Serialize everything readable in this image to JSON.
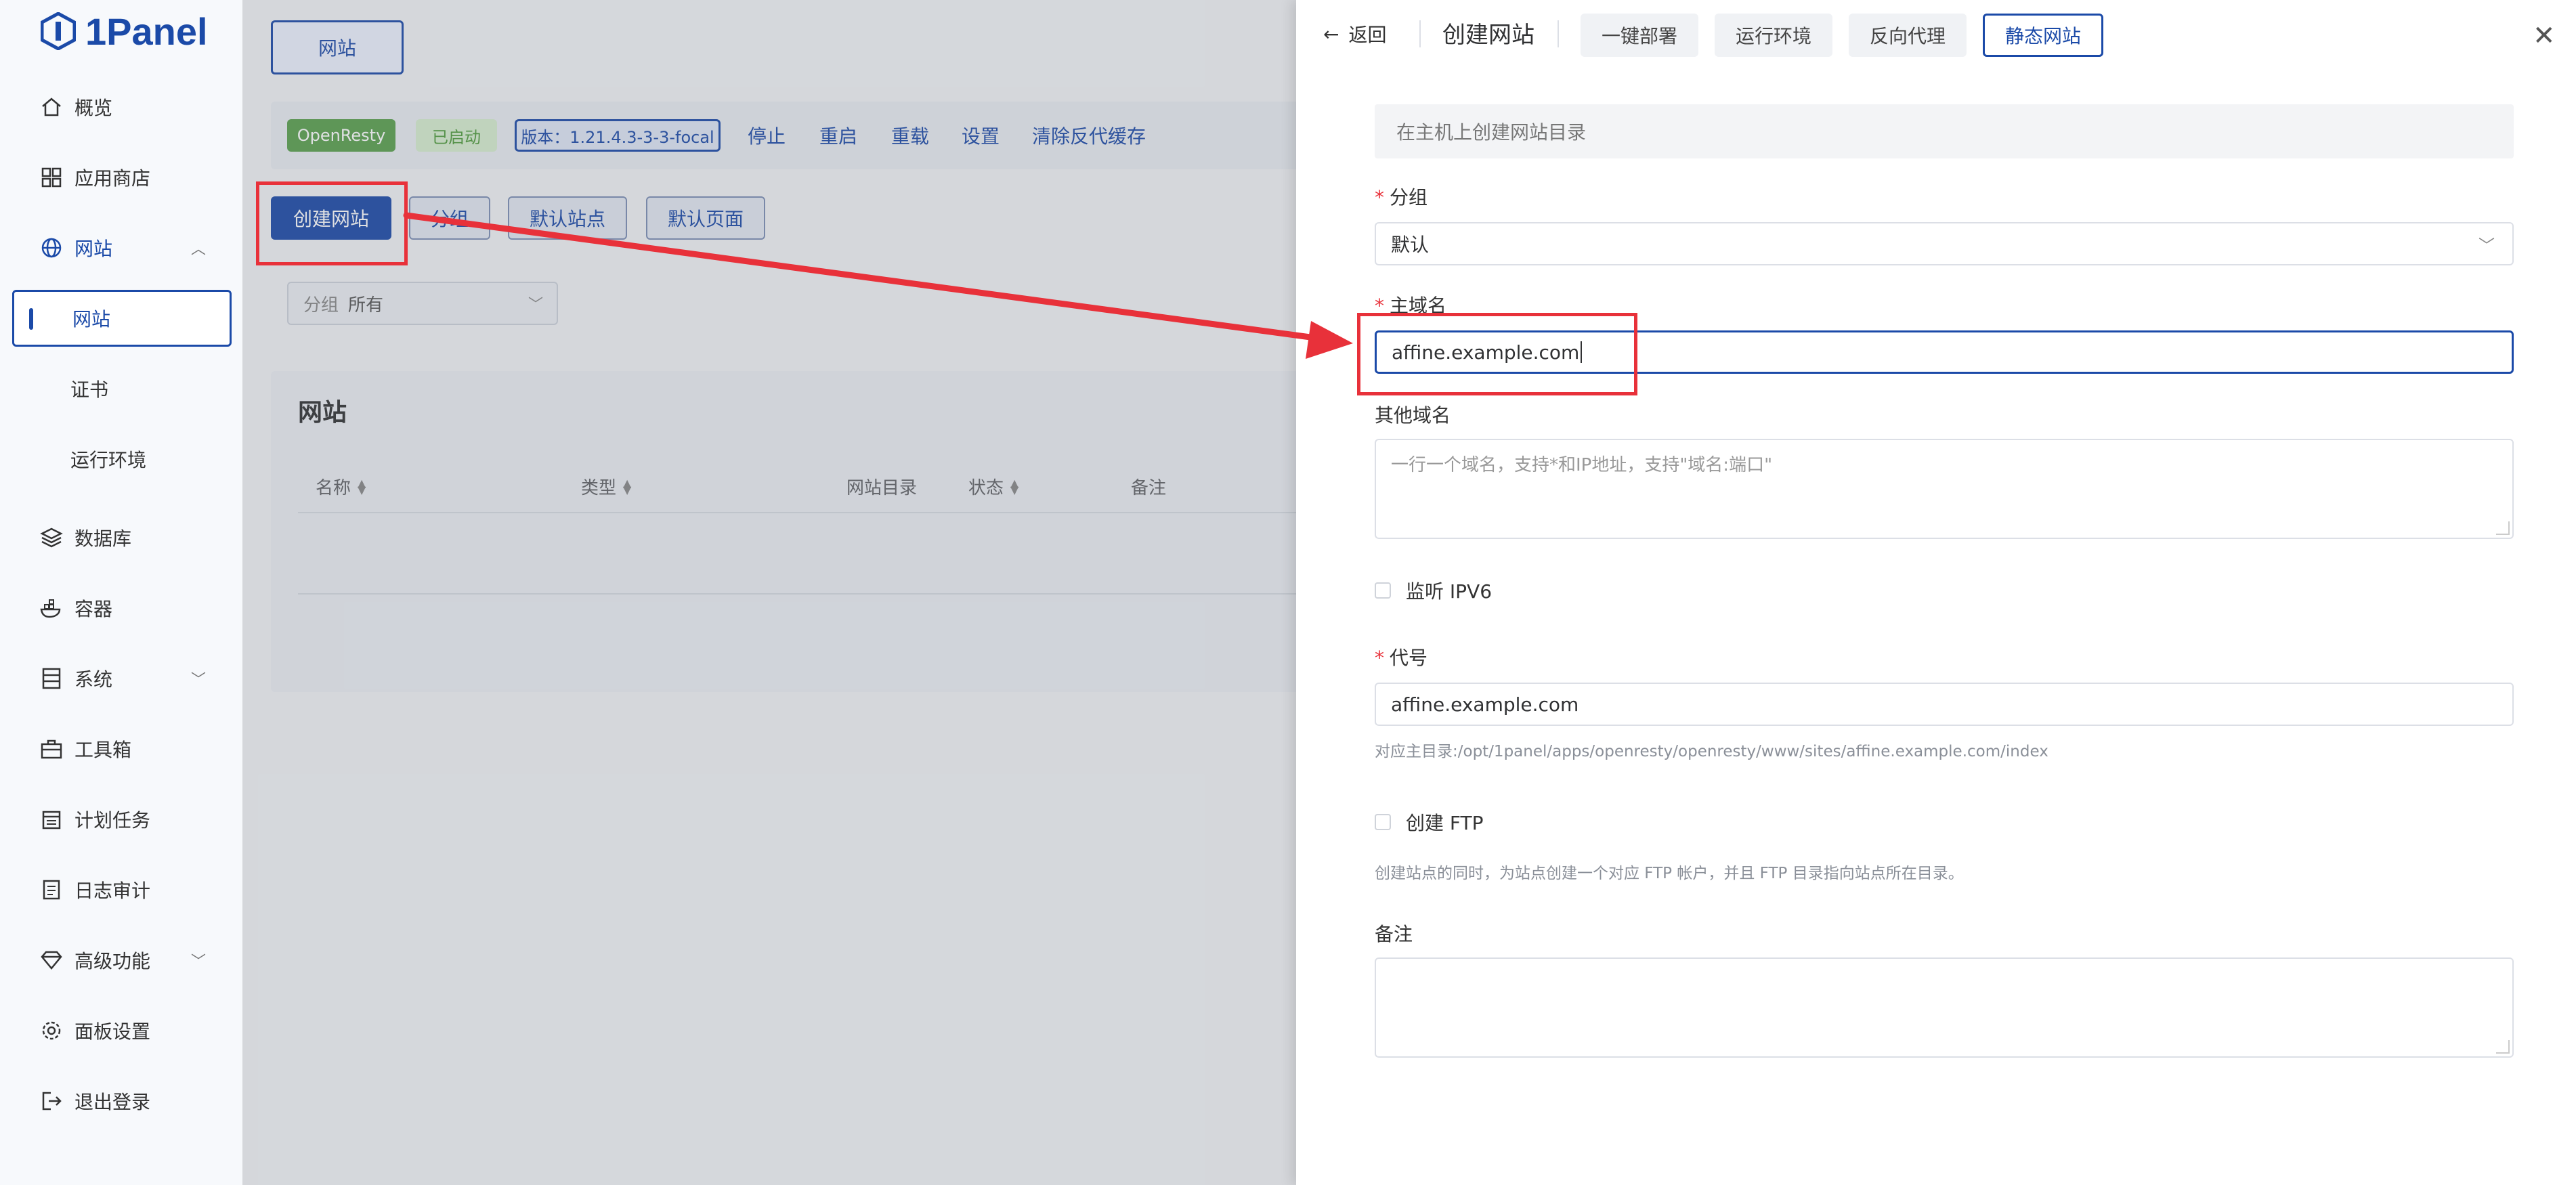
{
  "app": {
    "logo_text": "1Panel"
  },
  "sidebar": {
    "items": [
      {
        "label": "概览",
        "icon": "home-icon"
      },
      {
        "label": "应用商店",
        "icon": "grid-icon"
      },
      {
        "label": "网站",
        "icon": "globe-icon"
      },
      {
        "label": "数据库",
        "icon": "layers-icon"
      },
      {
        "label": "容器",
        "icon": "whale-icon"
      },
      {
        "label": "系统",
        "icon": "server-icon"
      },
      {
        "label": "工具箱",
        "icon": "toolbox-icon"
      },
      {
        "label": "计划任务",
        "icon": "calendar-icon"
      },
      {
        "label": "日志审计",
        "icon": "log-icon"
      },
      {
        "label": "高级功能",
        "icon": "diamond-icon"
      },
      {
        "label": "面板设置",
        "icon": "gear-icon"
      },
      {
        "label": "退出登录",
        "icon": "logout-icon"
      }
    ],
    "website_sub": [
      "网站",
      "证书",
      "运行环境"
    ]
  },
  "main": {
    "tab_label": "网站",
    "openresty": {
      "name": "OpenResty",
      "status": "已启动",
      "version": "版本：1.21.4.3-3-3-focal",
      "actions": [
        "停止",
        "重启",
        "重载",
        "设置",
        "清除反代缓存"
      ]
    },
    "toolbar": {
      "create": "创建网站",
      "group": "分组",
      "default_site": "默认站点",
      "default_page": "默认页面"
    },
    "filter": {
      "key": "分组",
      "value": "所有"
    },
    "card_title": "网站",
    "columns": [
      "名称",
      "类型",
      "网站目录",
      "状态",
      "备注"
    ]
  },
  "drawer": {
    "back": "返回",
    "title": "创建网站",
    "tabs": [
      "一键部署",
      "运行环境",
      "反向代理",
      "静态网站"
    ],
    "hint": "在主机上创建网站目录",
    "group_label": "分组",
    "group_value": "默认",
    "domain_label": "主域名",
    "domain_value": "affine.example.com",
    "other_domains_label": "其他域名",
    "other_domains_placeholder": "一行一个域名，支持*和IP地址，支持\"域名:端口\"",
    "ipv6_label": "监听 IPV6",
    "alias_label": "代号",
    "alias_value": "affine.example.com",
    "alias_help": "对应主目录:/opt/1panel/apps/openresty/openresty/www/sites/affine.example.com/index",
    "ftp_label": "创建 FTP",
    "ftp_help": "创建站点的同时，为站点创建一个对应 FTP 帐户，并且 FTP 目录指向站点所在目录。",
    "remark_label": "备注"
  },
  "colors": {
    "brand": "#1b4aa8",
    "annotation": "#e8313a",
    "status_green": "#5aa14d"
  }
}
